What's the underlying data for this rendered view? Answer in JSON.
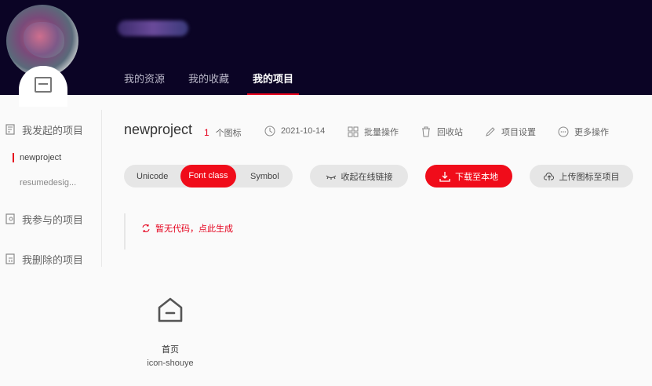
{
  "header": {
    "nav": [
      "我的资源",
      "我的收藏",
      "我的项目"
    ],
    "active_nav": 2
  },
  "sidebar": {
    "group_started": "我发起的项目",
    "items": [
      "newproject",
      "resumedesig..."
    ],
    "group_joined": "我参与的项目",
    "group_deleted": "我删除的项目"
  },
  "project": {
    "title": "newproject",
    "count": "1",
    "count_unit": "个图标",
    "date": "2021-10-14",
    "batch": "批量操作",
    "recycle": "回收站",
    "settings": "项目设置",
    "more": "更多操作"
  },
  "toolbar": {
    "seg": [
      "Unicode",
      "Font class",
      "Symbol"
    ],
    "collapse": "收起在线链接",
    "download": "下载至本地",
    "upload": "上传图标至项目"
  },
  "code": {
    "empty_msg": "暂无代码，点此生成"
  },
  "icon": {
    "name": "首页",
    "code": "icon-shouye"
  },
  "colors": {
    "header_bg": "#0b0425",
    "accent": "#f00c1a"
  }
}
